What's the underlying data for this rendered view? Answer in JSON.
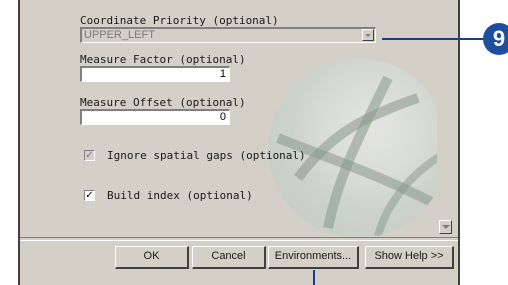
{
  "form": {
    "coordinate_priority": {
      "label": "Coordinate Priority (optional)",
      "value": "UPPER_LEFT"
    },
    "measure_factor": {
      "label": "Measure Factor (optional)",
      "value": "1"
    },
    "measure_offset": {
      "label": "Measure Offset (optional)",
      "value": "0"
    },
    "ignore_gaps": {
      "label": "Ignore spatial gaps (optional)",
      "checked": true,
      "enabled": false,
      "mark": "✓"
    },
    "build_index": {
      "label": "Build index (optional)",
      "checked": true,
      "mark": "✓"
    }
  },
  "buttons": {
    "ok": "OK",
    "cancel": "Cancel",
    "environments": "Environments...",
    "show_help": "Show Help >>"
  },
  "callout": {
    "number": "9",
    "color": "#1d4f9e"
  },
  "icons": [
    "dropdown-arrow-icon",
    "checkbox-icon",
    "scroll-down-arrow-icon",
    "globe-watermark-icon",
    "callout-badge-icon"
  ]
}
